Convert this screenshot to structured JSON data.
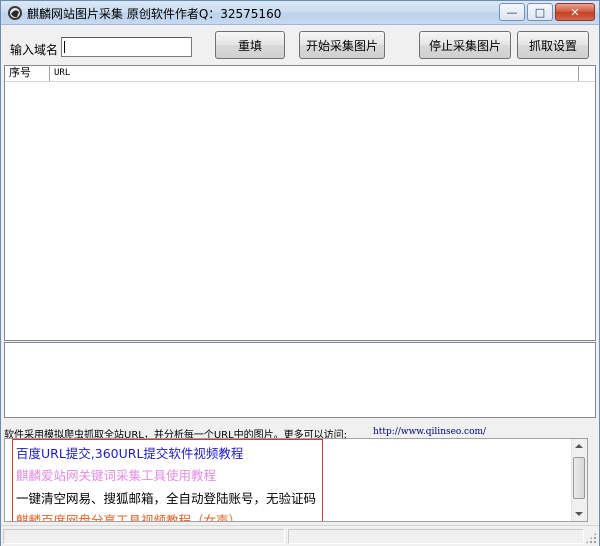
{
  "window": {
    "title": "麒麟网站图片采集 原创软件作者Q：32575160",
    "controls": {
      "minimize": "—",
      "maximize": "□",
      "close": "✕"
    }
  },
  "form": {
    "domain_label": "输入域名",
    "domain_value": "",
    "buttons": {
      "reset": "重填",
      "start": "开始采集图片",
      "stop": "停止采集图片",
      "settings": "抓取设置"
    }
  },
  "list": {
    "columns": [
      "序号",
      "URL"
    ],
    "rows": []
  },
  "info": {
    "text": "软件采用模拟爬虫抓取全站URL，并分析每一个URL中的图片。更多可以访问:",
    "link": "http://www.qilinseo.com/"
  },
  "links": [
    {
      "text": "百度URL提交,360URL提交软件视频教程",
      "color": "#1c1cc8"
    },
    {
      "text": "麒麟爱站网关键词采集工具使用教程",
      "color": "#e58be6"
    },
    {
      "text": "一键清空网易、搜狐邮箱，全自动登陆账号，无验证码",
      "color": "#000000"
    },
    {
      "text": "麒麟百度网盘分享工具视频教程（女声）",
      "color": "#e4642a"
    }
  ],
  "colors": {
    "titlebar": "#c9dcf1",
    "link_frame": "#d23a3a",
    "info_link": "#000080"
  }
}
